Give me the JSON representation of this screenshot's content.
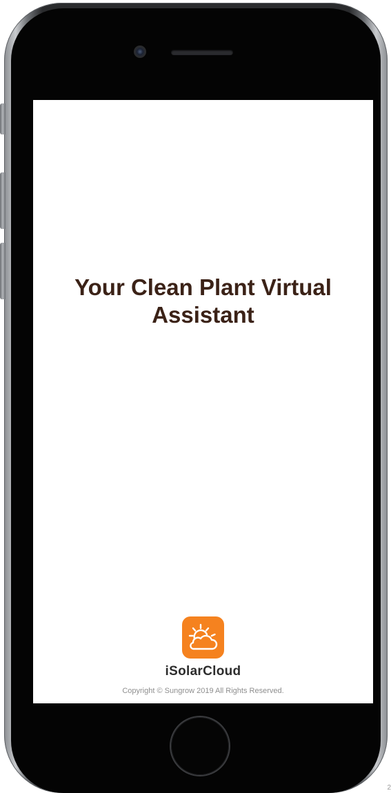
{
  "screen": {
    "headline": "Your Clean Plant Virtual Assistant",
    "brand": {
      "name": "iSolarCloud",
      "icon": "sun-cloud-icon",
      "icon_color": "#f5821f"
    },
    "copyright": "Copyright © Sungrow 2019 All Rights Reserved."
  },
  "device": {
    "type": "iPhone",
    "corner_mark": "2"
  },
  "colors": {
    "headline": "#3b2217",
    "brand_accent": "#f5821f",
    "copyright": "#8e8e8e"
  }
}
